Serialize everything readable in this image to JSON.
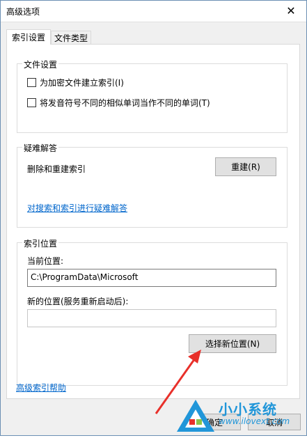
{
  "window": {
    "title": "高级选项",
    "close_glyph": "✕"
  },
  "tabs": [
    {
      "label": "索引设置",
      "active": true
    },
    {
      "label": "文件类型",
      "active": false
    }
  ],
  "file_settings": {
    "legend": "文件设置",
    "options": [
      {
        "label": "为加密文件建立索引(I)",
        "checked": false
      },
      {
        "label": "将发音符号不同的相似单词当作不同的单词(T)",
        "checked": false
      }
    ]
  },
  "troubleshooting": {
    "legend": "疑难解答",
    "rebuild_text": "删除和重建索引",
    "rebuild_button": "重建(R)",
    "troubleshoot_link": "对搜索和索引进行疑难解答"
  },
  "index_location": {
    "legend": "索引位置",
    "current_label": "当前位置:",
    "current_value": "C:\\ProgramData\\Microsoft",
    "new_label": "新的位置(服务重新启动后):",
    "new_value": "",
    "select_button": "选择新位置(N)"
  },
  "help_link": "高级索引帮助",
  "footer": {
    "ok_label": "确定",
    "cancel_label": "取消"
  },
  "watermark": {
    "name": "小小系统",
    "url": "www.ilovext.com"
  },
  "colors": {
    "link": "#0066cc",
    "annotation_arrow": "#e8302a",
    "watermark": "#2196d9"
  }
}
